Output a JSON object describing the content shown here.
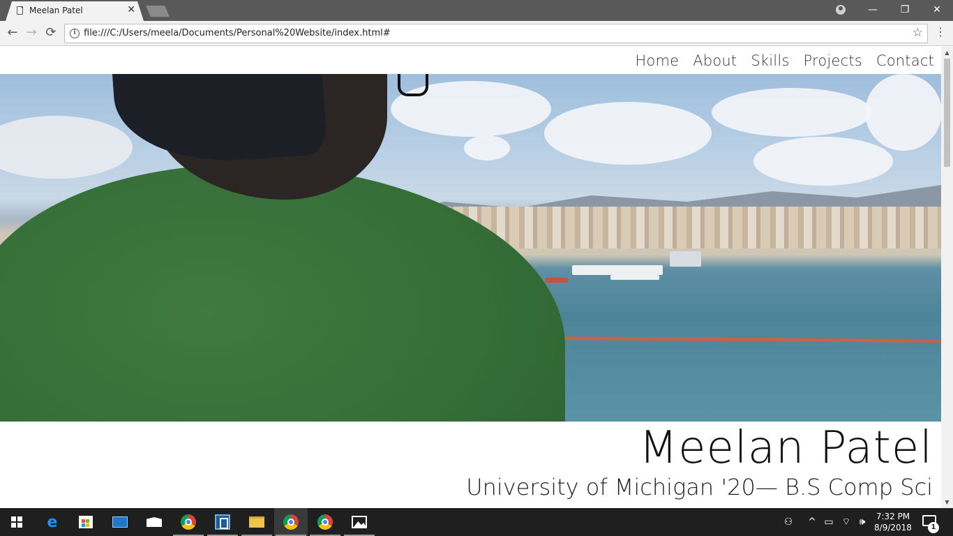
{
  "browser": {
    "tab_title": "Meelan Patel",
    "tab_close": "✕",
    "url": "file:///C:/Users/meela/Documents/Personal%20Website/index.html#",
    "back": "←",
    "forward": "→",
    "reload": "⟳",
    "info": "i",
    "star": "☆",
    "menu": "⋮",
    "minimize": "—",
    "restore": "❐",
    "close": "✕"
  },
  "site": {
    "nav": [
      "Home",
      "About",
      "Skills",
      "Projects",
      "Contact"
    ],
    "name": "Meelan Patel",
    "subtitle": "University of Michigan '20— B.S Comp Sci"
  },
  "scrollbar": {
    "up": "▲",
    "down": "▼"
  },
  "taskbar": {
    "time": "7:32 PM",
    "date": "8/9/2018",
    "notification_count": "1",
    "tray": {
      "people": "⚇",
      "chevron": "^",
      "battery": "▭",
      "wifi": "⌔",
      "volume": "🕪"
    }
  }
}
